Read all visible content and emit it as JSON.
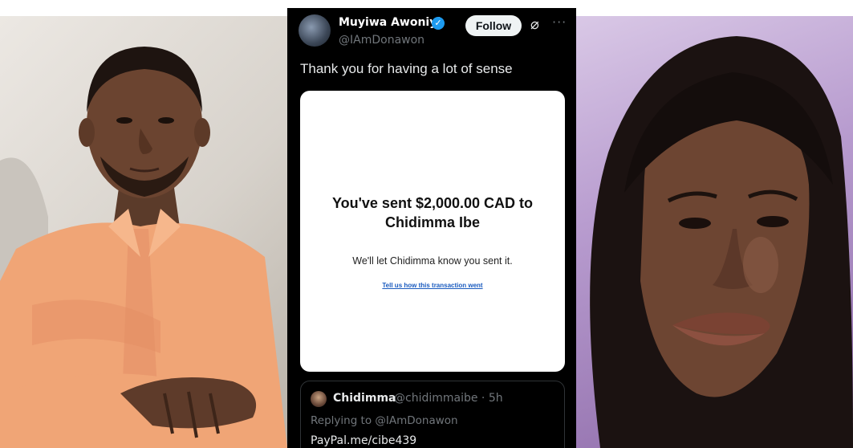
{
  "tweet": {
    "author_name": "Muyiwa Awoniyi",
    "author_handle": "@IAmDonawon",
    "follow_label": "Follow",
    "text": "Thank you for having a lot of sense",
    "icons": [
      "verified-badge-icon",
      "grok-icon",
      "more-icon"
    ],
    "embedded_image": {
      "title": "You've sent $2,000.00 CAD to Chidimma Ibe",
      "subtitle": "We'll let Chidimma know you sent it.",
      "link": "Tell us how this transaction went"
    },
    "quoted": {
      "name": "Chidimma",
      "meta": "@chidimmaibe · 5h",
      "reply_to": "Replying to @IAmDonawon",
      "text": "PayPal.me/cibe439"
    }
  },
  "colors": {
    "tweet_background": "#000000",
    "verified_blue": "#1d9bf0",
    "link_blue": "#1a5bbf"
  }
}
